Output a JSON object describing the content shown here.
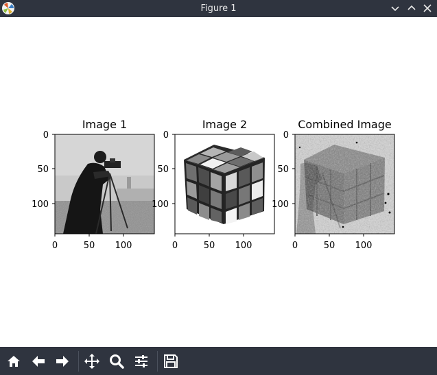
{
  "window": {
    "title": "Figure 1",
    "icons": [
      "app-icon",
      "minimize-icon",
      "maximize-icon",
      "close-icon"
    ]
  },
  "figure": {
    "subplots": [
      {
        "title": "Image 1",
        "xticks": [
          "0",
          "50",
          "100"
        ],
        "yticks": [
          "0",
          "50",
          "100"
        ],
        "content": "grayscale photo of a cameraman with tripod"
      },
      {
        "title": "Image 2",
        "xticks": [
          "0",
          "50",
          "100"
        ],
        "yticks": [
          "0",
          "50",
          "100"
        ],
        "content": "grayscale Rubik's cube"
      },
      {
        "title": "Combined Image",
        "xticks": [
          "0",
          "50",
          "100"
        ],
        "yticks": [
          "0",
          "50",
          "100"
        ],
        "content": "noisy blended image of the cube"
      }
    ]
  },
  "toolbar": {
    "buttons": [
      {
        "name": "home",
        "icon": "home-icon"
      },
      {
        "name": "back",
        "icon": "arrow-left-icon"
      },
      {
        "name": "forward",
        "icon": "arrow-right-icon"
      },
      {
        "name": "pan",
        "icon": "move-icon"
      },
      {
        "name": "zoom",
        "icon": "zoom-icon"
      },
      {
        "name": "configure-subplots",
        "icon": "sliders-icon"
      },
      {
        "name": "save",
        "icon": "save-icon"
      }
    ]
  }
}
